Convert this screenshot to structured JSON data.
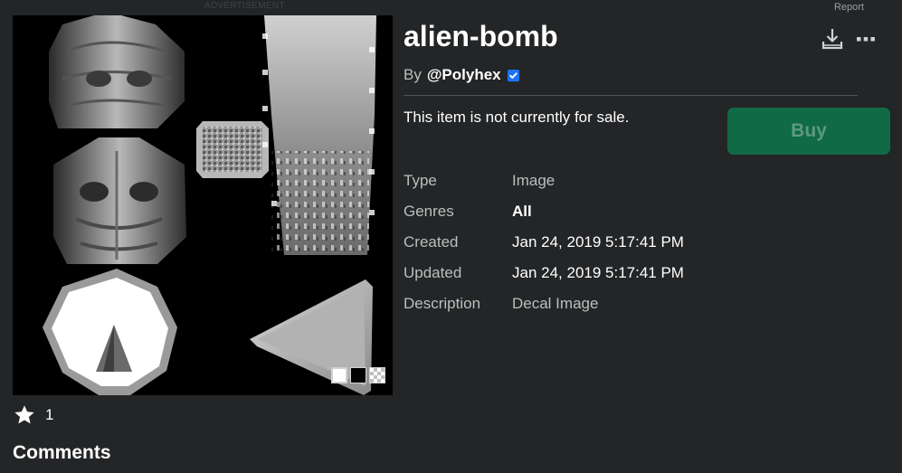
{
  "ad": {
    "label": "ADVERTISEMENT"
  },
  "report": {
    "label": "Report"
  },
  "item": {
    "title": "alien-bomb",
    "by_prefix": "By",
    "creator": "@Polyhex",
    "sale_status": "This item is not currently for sale.",
    "buy_label": "Buy"
  },
  "details": [
    {
      "label": "Type",
      "value": "Image"
    },
    {
      "label": "Genres",
      "value": "All"
    },
    {
      "label": "Created",
      "value": "Jan 24, 2019 5:17:41 PM"
    },
    {
      "label": "Updated",
      "value": "Jan 24, 2019 5:17:41 PM"
    },
    {
      "label": "Description",
      "value": "Decal Image"
    }
  ],
  "favorites": {
    "count": "1"
  },
  "comments": {
    "title": "Comments"
  },
  "icons": {
    "download": "download-icon",
    "more": "more-options-icon",
    "verified": "verified-badge-icon",
    "favorite": "star-icon"
  },
  "colors": {
    "background": "#232527",
    "buy_button": "#0f6a45",
    "buy_text": "#5e9a7c",
    "verified": "#1d72f2",
    "thumbnail_bg": "#000000"
  }
}
